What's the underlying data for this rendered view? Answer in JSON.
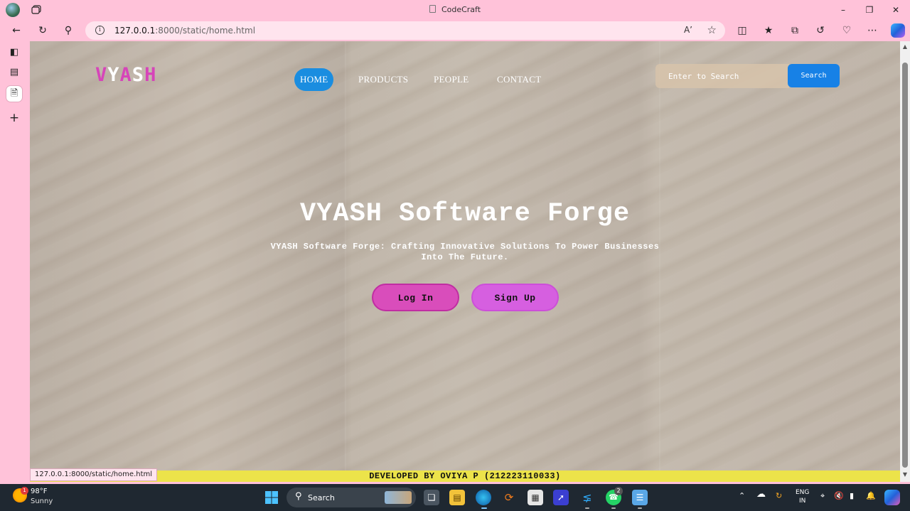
{
  "browser": {
    "window_title": "CodeCraft",
    "url_host": "127.0.0.1",
    "url_path": ":8000/static/home.html",
    "read_aloud_label": "A’",
    "status_url": "127.0.0.1:8000/static/home.html"
  },
  "site": {
    "logo_letters": [
      "V",
      "Y",
      "A",
      "S",
      "H"
    ],
    "nav": [
      {
        "label": "HOME",
        "active": true
      },
      {
        "label": "PRODUCTS",
        "active": false
      },
      {
        "label": "PEOPLE",
        "active": false
      },
      {
        "label": "CONTACT",
        "active": false
      }
    ],
    "search": {
      "placeholder": "Enter to Search",
      "button_label": "Search"
    },
    "hero": {
      "title": "VYASH Software Forge",
      "subtitle_line1": "VYASH Software Forge: Crafting Innovative Solutions To Power Businesses",
      "subtitle_line2": "Into The Future.",
      "login_label": "Log In",
      "signup_label": "Sign Up"
    },
    "footer_text": "DEVELOPED BY OVIYA P (212223110033)",
    "colors": {
      "logo_pink": "#d645b9",
      "nav_active": "#1a8de0",
      "search_button": "#1781e6",
      "footer_bg": "#ece34a",
      "login_bg": "#d94dbb",
      "signup_bg": "#d65fe0"
    }
  },
  "taskbar": {
    "weather_temp": "98°F",
    "weather_condition": "Sunny",
    "weather_badge": "1",
    "search_label": "Search",
    "whatsapp_badge": "2",
    "lang_line1": "ENG",
    "lang_line2": "IN"
  }
}
